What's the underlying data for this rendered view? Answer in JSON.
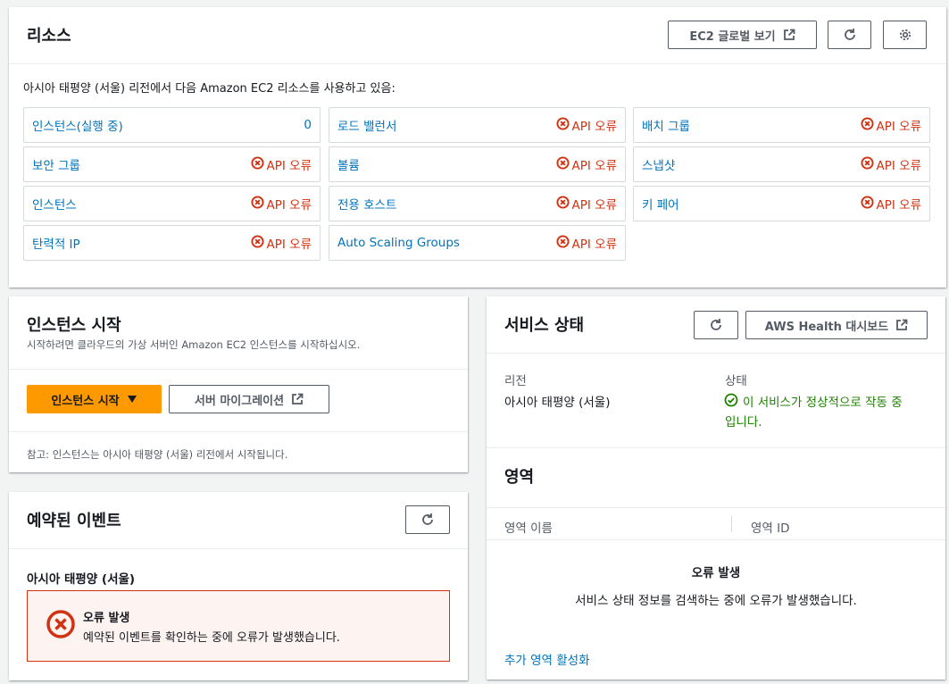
{
  "resources": {
    "title": "리소스",
    "global_view_label": "EC2 글로벌 보기",
    "intro": "아시아 태평양 (서울) 리전에서 다음 Amazon EC2 리소스를 사용하고 있음:",
    "items": [
      {
        "name": "인스턴스(실행 중)",
        "value": "0"
      },
      {
        "name": "로드 밸런서",
        "value": "API 오류"
      },
      {
        "name": "배치 그룹",
        "value": "API 오류"
      },
      {
        "name": "보안 그룹",
        "value": "API 오류"
      },
      {
        "name": "볼륨",
        "value": "API 오류"
      },
      {
        "name": "스냅샷",
        "value": "API 오류"
      },
      {
        "name": "인스턴스",
        "value": "API 오류"
      },
      {
        "name": "전용 호스트",
        "value": "API 오류"
      },
      {
        "name": "키 페어",
        "value": "API 오류"
      },
      {
        "name": "탄력적 IP",
        "value": "API 오류"
      },
      {
        "name": "Auto Scaling Groups",
        "value": "API 오류"
      }
    ]
  },
  "launch": {
    "title": "인스턴스 시작",
    "description": "시작하려면 클라우드의 가상 서버인 Amazon EC2 인스턴스를 시작하십시오.",
    "launch_label": "인스턴스 시작",
    "migrate_label": "서버 마이그레이션",
    "note": "참고: 인스턴스는 아시아 태평양 (서울) 리전에서 시작됩니다."
  },
  "events": {
    "title": "예약된 이벤트",
    "region": "아시아 태평양 (서울)",
    "error_title": "오류 발생",
    "error_message": "예약된 이벤트를 확인하는 중에 오류가 발생했습니다."
  },
  "health": {
    "title": "서비스 상태",
    "dashboard_label": "AWS Health 대시보드",
    "region_label": "리전",
    "region_value": "아시아 태평양 (서울)",
    "status_label": "상태",
    "status_value_line1": "이 서비스가 정상적으로 작동 중",
    "status_value_line2": "입니다."
  },
  "zones": {
    "title": "영역",
    "col_name": "영역 이름",
    "col_id": "영역 ID",
    "error_title": "오류 발생",
    "error_message": "서비스 상태 정보를 검색하는 중에 오류가 발생했습니다.",
    "enable_link": "추가 영역 활성화"
  },
  "colors": {
    "link": "#0073bb",
    "error": "#d13212",
    "success": "#1d8102",
    "primary": "#ff9900"
  }
}
